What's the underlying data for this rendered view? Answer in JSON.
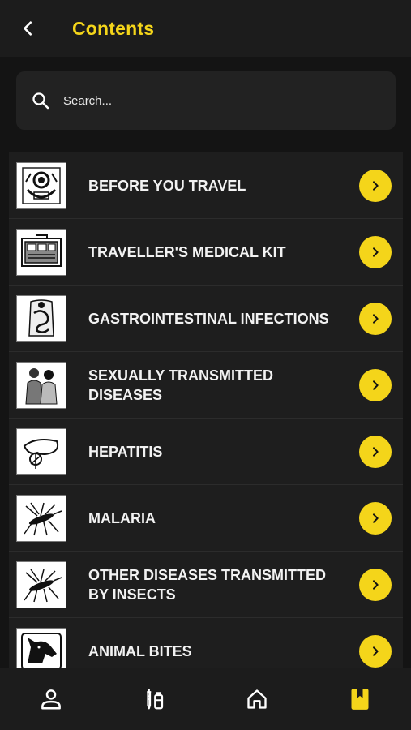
{
  "appbar": {
    "title": "Contents"
  },
  "search": {
    "placeholder": "Search..."
  },
  "items": [
    {
      "label": "BEFORE YOU TRAVEL",
      "icon": "stethoscope-icon"
    },
    {
      "label": "TRAVELLER'S MEDICAL KIT",
      "icon": "medical-kit-icon"
    },
    {
      "label": "GASTROINTESTINAL INFECTIONS",
      "icon": "stomach-icon"
    },
    {
      "label": "SEXUALLY TRANSMITTED DISEASES",
      "icon": "couple-icon"
    },
    {
      "label": "HEPATITIS",
      "icon": "liver-icon"
    },
    {
      "label": "MALARIA",
      "icon": "mosquito-icon"
    },
    {
      "label": "OTHER DISEASES TRANSMITTED BY INSECTS",
      "icon": "mosquito-icon"
    },
    {
      "label": "ANIMAL BITES",
      "icon": "dog-icon"
    }
  ],
  "nav": [
    {
      "name": "profile",
      "icon": "person-icon"
    },
    {
      "name": "vaccines",
      "icon": "syringe-vial-icon"
    },
    {
      "name": "home",
      "icon": "home-icon"
    },
    {
      "name": "contents",
      "icon": "bookmark-book-icon"
    }
  ],
  "colors": {
    "accent": "#f4d51a",
    "background": "#141414",
    "surface": "#1e1e1e"
  }
}
